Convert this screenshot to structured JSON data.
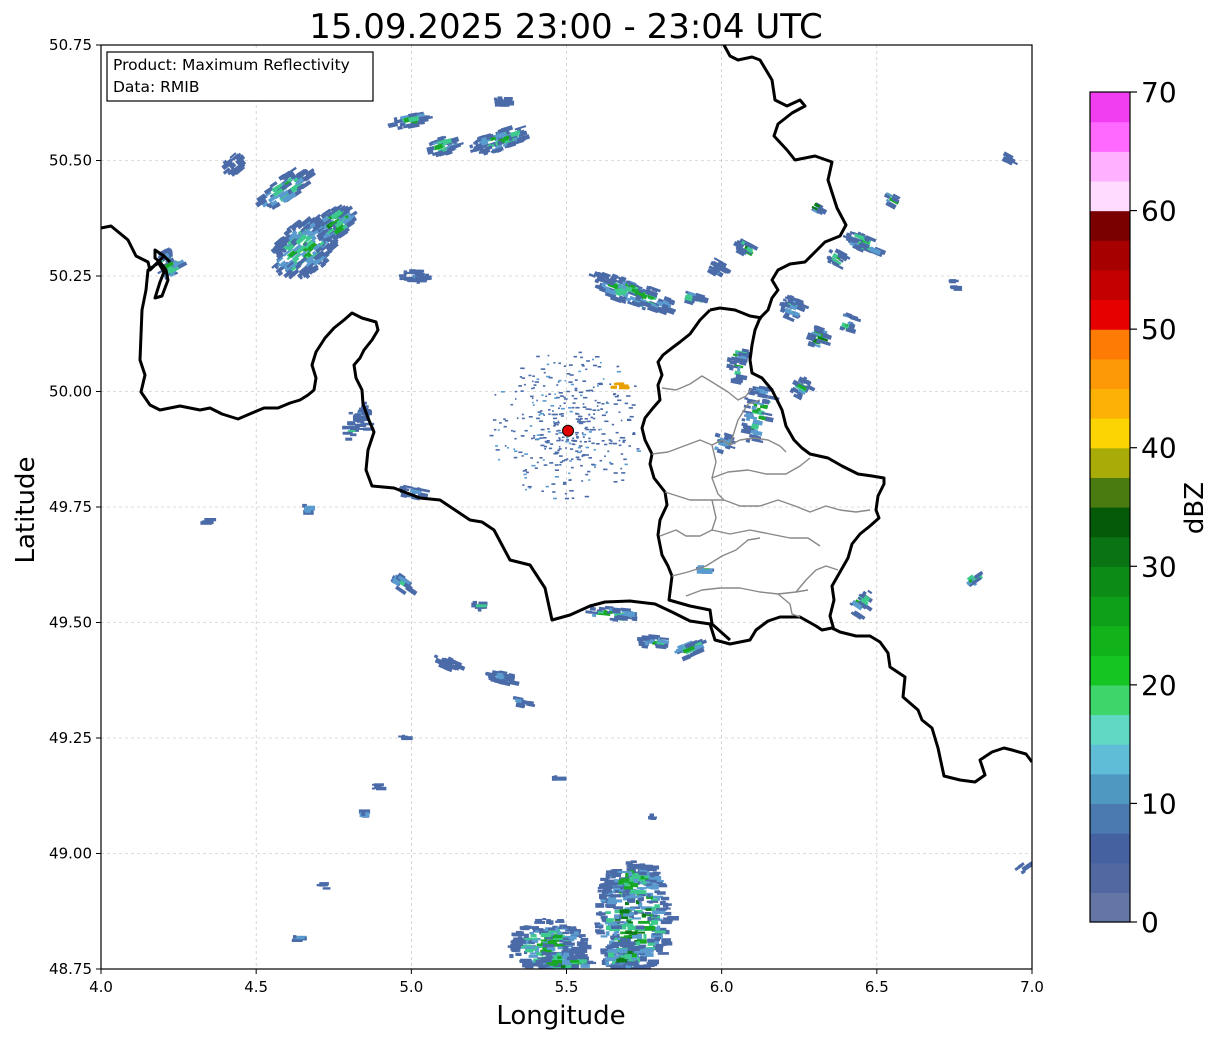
{
  "title": "15.09.2025 23:00 - 23:04 UTC",
  "info_box": {
    "product": "Product: Maximum Reflectivity",
    "data": "Data: RMIB"
  },
  "axes": {
    "xlabel": "Longitude",
    "ylabel": "Latitude",
    "xlim": [
      4.0,
      7.0
    ],
    "ylim": [
      48.75,
      50.75
    ],
    "xticks": [
      "4.0",
      "4.5",
      "5.0",
      "5.5",
      "6.0",
      "6.5",
      "7.0"
    ],
    "yticks": [
      "48.75",
      "49.00",
      "49.25",
      "49.50",
      "49.75",
      "50.00",
      "50.25",
      "50.50",
      "50.75"
    ],
    "grid": "dashed"
  },
  "colorbar": {
    "label": "dBZ",
    "range": [
      0,
      70
    ],
    "ticks": [
      "0",
      "10",
      "20",
      "30",
      "40",
      "50",
      "60",
      "70"
    ],
    "colors": [
      "#6575a6",
      "#5268a0",
      "#46619f",
      "#4a7ab0",
      "#4e98c2",
      "#60bdd8",
      "#61d8c4",
      "#3ed66a",
      "#15c521",
      "#12b21b",
      "#0fa01a",
      "#0c8b17",
      "#0a7313",
      "#045a08",
      "#497b10",
      "#a8ab08",
      "#fcd303",
      "#fdb106",
      "#fd9806",
      "#fe7c05",
      "#e60000",
      "#c50000",
      "#a70000",
      "#7a0000",
      "#ffdcff",
      "#ffb1ff",
      "#ff69ff",
      "#f03ef0"
    ]
  },
  "radar_site": {
    "lon": 5.505,
    "lat": 49.915,
    "color": "#e00000"
  },
  "echo_colors": {
    "weak": "#4a6aa8",
    "light": "#5a9ccf",
    "moderate": "#3ec98e",
    "strong": "#18a826",
    "core": "#0b7d16",
    "hail": "#e8a000"
  }
}
